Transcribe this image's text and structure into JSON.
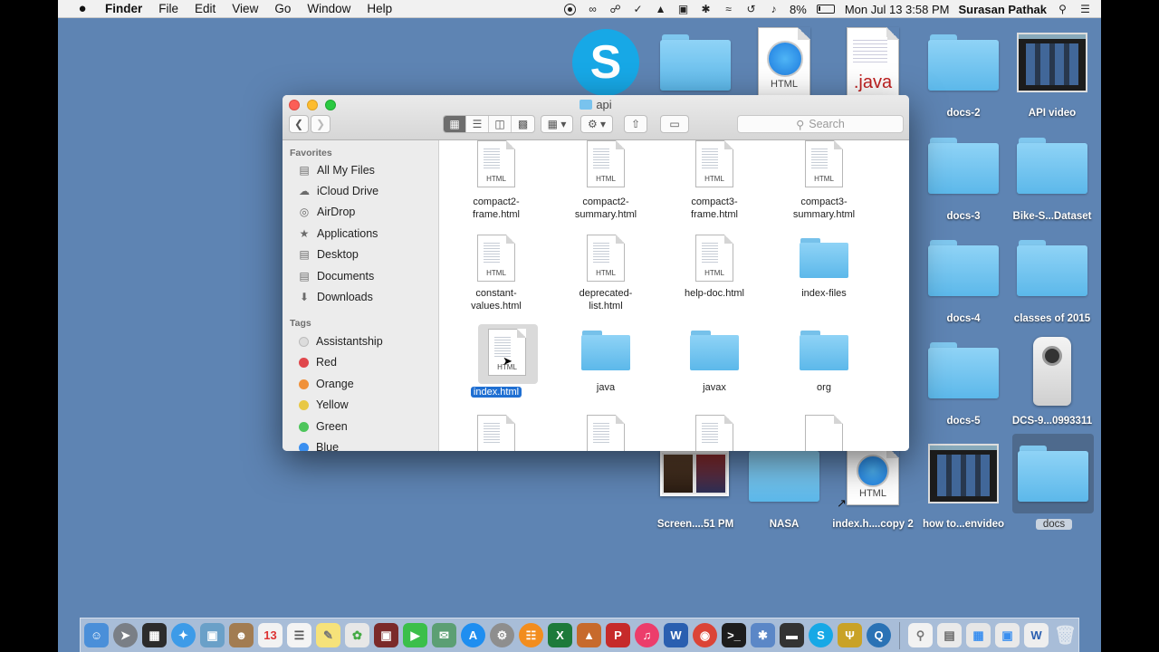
{
  "menubar": {
    "apple": "",
    "app": "Finder",
    "menus": [
      "File",
      "Edit",
      "View",
      "Go",
      "Window",
      "Help"
    ],
    "battery": "8%",
    "datetime": "Mon Jul 13  3:58 PM",
    "user": "Surasan Pathak"
  },
  "desktop": {
    "icons": {
      "docs2": "docs-2",
      "api_video": "API video",
      "docs3": "docs-3",
      "bike": "Bike-S...Dataset",
      "docs4": "docs-4",
      "classes": "classes of 2015",
      "docs5": "docs-5",
      "dcs": "DCS-9...0993311",
      "screenshot": "Screen....51 PM",
      "nasa": "NASA",
      "index_copy": "index.h....copy 2",
      "howto": "how to...envideo",
      "docs": "docs"
    },
    "html_ext": "HTML",
    "java_ext": ".java"
  },
  "finder": {
    "title": "api",
    "search_placeholder": "Search",
    "sidebar": {
      "favorites_header": "Favorites",
      "favorites": [
        "All My Files",
        "iCloud Drive",
        "AirDrop",
        "Applications",
        "Desktop",
        "Documents",
        "Downloads"
      ],
      "tags_header": "Tags",
      "tags": [
        "Assistantship",
        "Red",
        "Orange",
        "Yellow",
        "Green",
        "Blue"
      ],
      "tag_colors": [
        "#dcdcdc",
        "#e0474c",
        "#f0913a",
        "#e8c845",
        "#4dc55b",
        "#3a8ff0"
      ]
    },
    "files": [
      "compact2-\nframe.html",
      "compact2-\nsummary.html",
      "compact3-\nframe.html",
      "compact3-\nsummary.html",
      "constant-\nvalues.html",
      "deprecated-\nlist.html",
      "help-doc.html",
      "index-files",
      "index.html",
      "java",
      "javax",
      "org"
    ],
    "doc_ext": "HTML"
  }
}
